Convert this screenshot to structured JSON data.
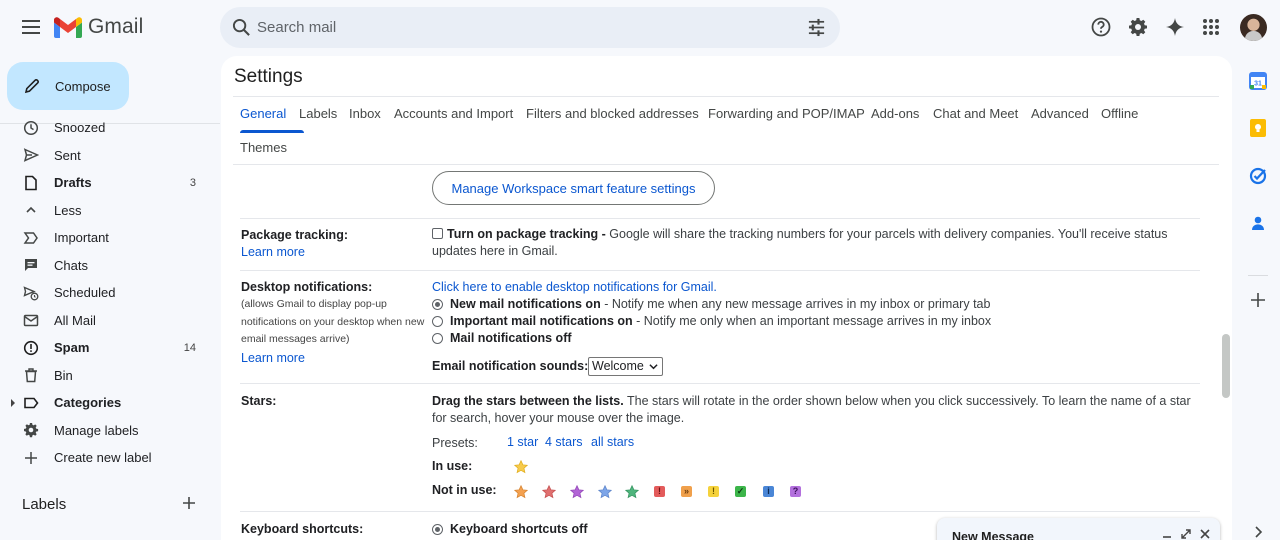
{
  "header": {
    "app_name": "Gmail",
    "search_placeholder": "Search mail"
  },
  "sidebar": {
    "compose_label": "Compose",
    "items": [
      {
        "label": "Snoozed",
        "icon": "clock-icon",
        "count": "",
        "bold": false
      },
      {
        "label": "Sent",
        "icon": "send-icon",
        "count": "",
        "bold": false
      },
      {
        "label": "Drafts",
        "icon": "draft-icon",
        "count": "3",
        "bold": true
      },
      {
        "label": "Less",
        "icon": "chevron-up-icon",
        "count": "",
        "bold": false
      },
      {
        "label": "Important",
        "icon": "important-icon",
        "count": "",
        "bold": false
      },
      {
        "label": "Chats",
        "icon": "chat-icon",
        "count": "",
        "bold": false
      },
      {
        "label": "Scheduled",
        "icon": "schedule-send-icon",
        "count": "",
        "bold": false
      },
      {
        "label": "All Mail",
        "icon": "all-mail-icon",
        "count": "",
        "bold": false
      },
      {
        "label": "Spam",
        "icon": "spam-icon",
        "count": "14",
        "bold": true
      },
      {
        "label": "Bin",
        "icon": "trash-icon",
        "count": "",
        "bold": false
      },
      {
        "label": "Categories",
        "icon": "label-icon",
        "count": "",
        "bold": true
      },
      {
        "label": "Manage labels",
        "icon": "gear-icon",
        "count": "",
        "bold": false
      },
      {
        "label": "Create new label",
        "icon": "plus-icon",
        "count": "",
        "bold": false
      }
    ],
    "labels_heading": "Labels"
  },
  "settings": {
    "title": "Settings",
    "tabs": [
      "General",
      "Labels",
      "Inbox",
      "Accounts and Import",
      "Filters and blocked addresses",
      "Forwarding and POP/IMAP",
      "Add-ons",
      "Chat and Meet",
      "Advanced",
      "Offline",
      "Themes"
    ],
    "active_tab": "General",
    "manage_button": "Manage Workspace smart feature settings",
    "package_tracking": {
      "label": "Package tracking:",
      "learn_more": "Learn more",
      "option_bold": "Turn on package tracking -",
      "option_text": " Google will share the tracking numbers for your parcels with delivery companies. You'll receive status updates here in Gmail."
    },
    "desktop_notifications": {
      "label": "Desktop notifications:",
      "sub": "(allows Gmail to display pop-up notifications on your desktop when new email messages arrive)",
      "learn_more": "Learn more",
      "enable_link": "Click here to enable desktop notifications for Gmail.",
      "opt1_bold": "New mail notifications on",
      "opt1_text": " - Notify me when any new message arrives in my inbox or primary tab",
      "opt2_bold": "Important mail notifications on",
      "opt2_text": " - Notify me only when an important message arrives in my inbox",
      "opt3_bold": "Mail notifications off",
      "sounds_label": "Email notification sounds:",
      "sounds_value": "Welcome"
    },
    "stars": {
      "label": "Stars:",
      "desc_bold": "Drag the stars between the lists.",
      "desc_text": "  The stars will rotate in the order shown below when you click successively. To learn the name of a star for search, hover your mouse over the image.",
      "presets_label": "Presets:",
      "preset_1": "1 star",
      "preset_4": "4 stars",
      "preset_all": "all stars",
      "in_use_label": "In use:",
      "not_in_use_label": "Not in use:",
      "colors": {
        "yellow": "#f7cb4d",
        "orange": "#f4a150",
        "red": "#e07070",
        "purple": "#b264d6",
        "blue": "#7da5e8",
        "green": "#4fb57d"
      }
    },
    "keyboard": {
      "label": "Keyboard shortcuts:",
      "opt_off": "Keyboard shortcuts off"
    }
  },
  "new_message": {
    "title": "New Message"
  }
}
